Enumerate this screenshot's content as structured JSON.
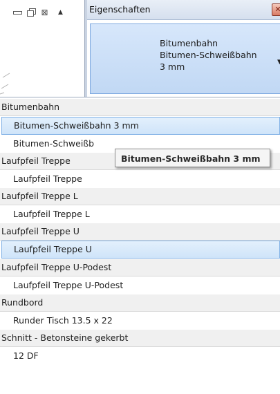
{
  "window_controls": {
    "minimize_icon": "minimize-icon",
    "restore_icon": "restore-icon",
    "close_icon": "close-icon",
    "scroll_up_icon": "scroll-up-arrow-icon"
  },
  "properties_panel": {
    "title": "Eigenschaften",
    "close_icon": "close-icon",
    "type_selector": {
      "line1": "Bitumenbahn",
      "line2": "Bitumen-Schweißbahn",
      "line3": "3 mm",
      "dropdown_icon": "dropdown-arrow-icon"
    }
  },
  "type_list": {
    "rows": [
      {
        "kind": "group",
        "label": "Bitumenbahn"
      },
      {
        "kind": "item",
        "label": "Bitumen-Schweißbahn 3 mm",
        "selected": true
      },
      {
        "kind": "item",
        "label": "Bitumen-Schweißb"
      },
      {
        "kind": "group",
        "label": "Laufpfeil Treppe"
      },
      {
        "kind": "item",
        "label": "Laufpfeil Treppe"
      },
      {
        "kind": "group",
        "label": "Laufpfeil Treppe L"
      },
      {
        "kind": "item",
        "label": "Laufpfeil Treppe L"
      },
      {
        "kind": "group",
        "label": "Laufpfeil Treppe U"
      },
      {
        "kind": "item",
        "label": "Laufpfeil Treppe U",
        "selected": true
      },
      {
        "kind": "group",
        "label": "Laufpfeil Treppe U-Podest"
      },
      {
        "kind": "item",
        "label": "Laufpfeil Treppe U-Podest"
      },
      {
        "kind": "group",
        "label": "Rundbord"
      },
      {
        "kind": "item",
        "label": "Runder Tisch 13.5 x 22"
      },
      {
        "kind": "group",
        "label": "Schnitt - Betonsteine gekerbt"
      },
      {
        "kind": "item",
        "label": "12 DF"
      }
    ],
    "tooltip": "Bitumen-Schweißbahn 3 mm"
  },
  "colors": {
    "selection": "#cfe4f9",
    "selection_border": "#82b2e6",
    "group_background": "#f0f0f0",
    "type_selector_background": "#c1d8f4"
  }
}
